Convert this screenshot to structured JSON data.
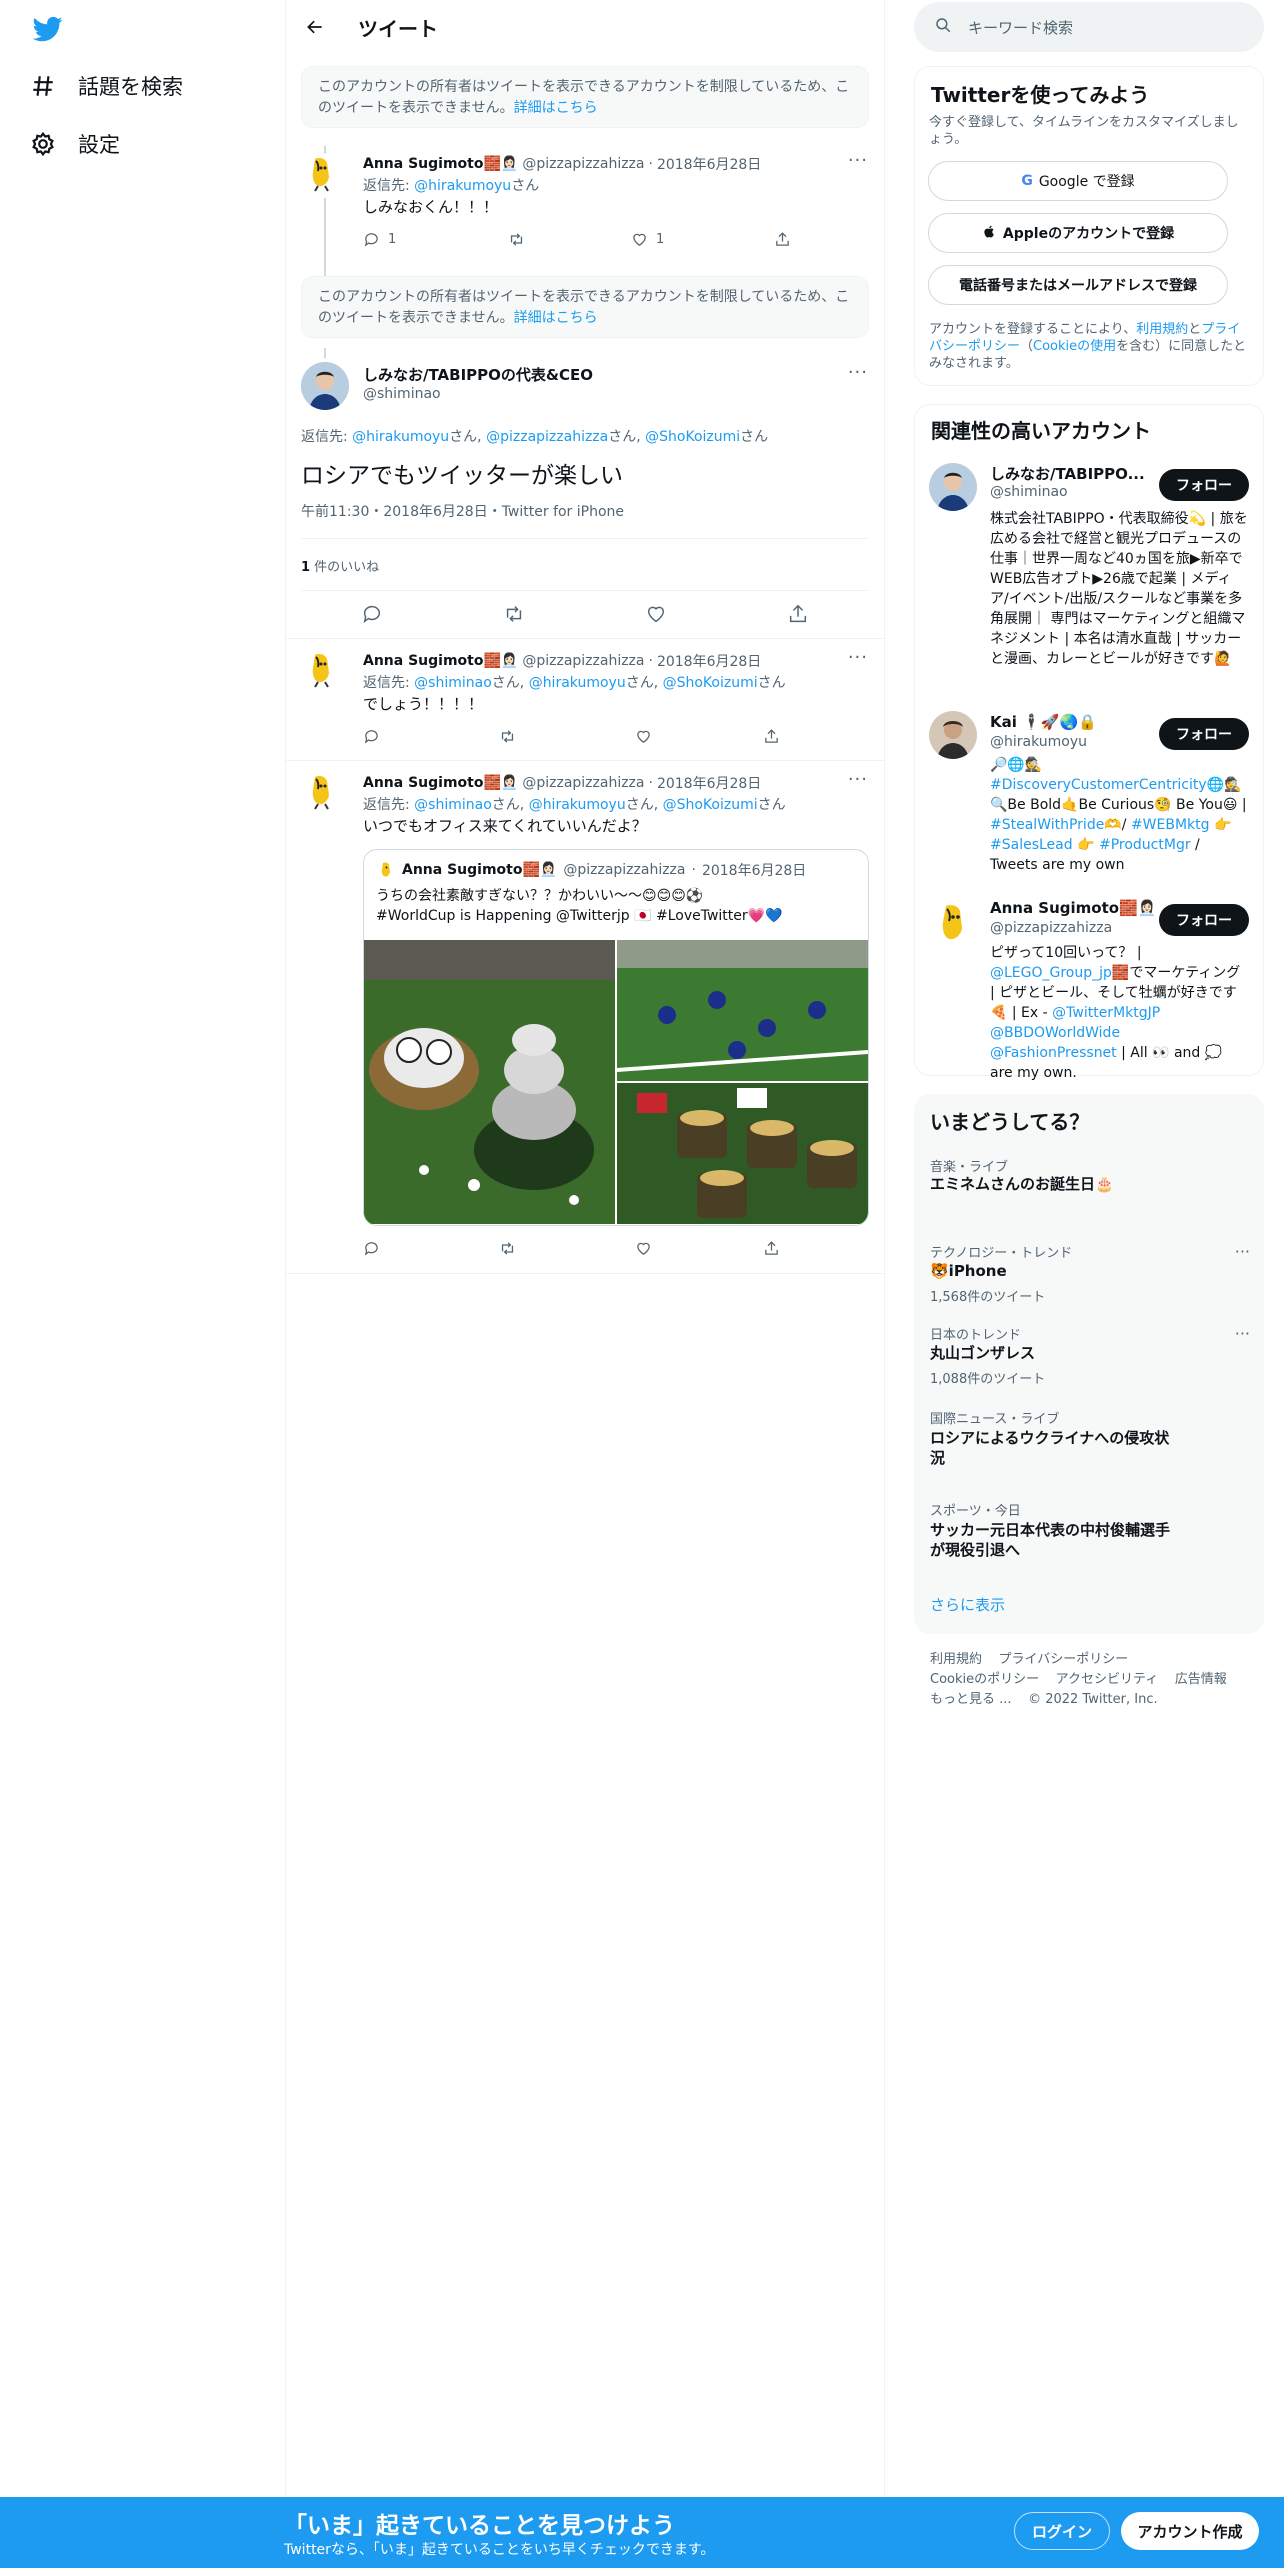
{
  "nav": {
    "explore_label": "話題を検索",
    "settings_label": "設定"
  },
  "header": {
    "title": "ツイート"
  },
  "notice": {
    "text": "このアカウントの所有者はツイートを表示できるアカウントを制限しているため、このツイートを表示できません。",
    "more_link": "詳細はこちら"
  },
  "tweet1": {
    "name": "Anna Sugimoto🧱👩🏻‍💼",
    "handle": "@pizzapizzahizza",
    "dot": "·",
    "date": "2018年6月28日",
    "reply_prefix": "返信先: ",
    "reply_to": "@hirakumoyu",
    "reply_suffix": "さん",
    "text": "しみなおくん！！！",
    "replies": "1",
    "likes": "1"
  },
  "focal": {
    "name": "しみなお/TABIPPOの代表&CEO",
    "handle": "@shiminao",
    "reply_prefix": "返信先: ",
    "reply_m1": "@hirakumoyu",
    "reply_s1": "さん, ",
    "reply_m2": "@pizzapizzahizza",
    "reply_s2": "さん, ",
    "reply_m3": "@ShoKoizumi",
    "reply_s3": "さん",
    "text": "ロシアでもツイッターが楽しい",
    "meta": "午前11:30・2018年6月28日・Twitter for iPhone",
    "likes_count": "1",
    "likes_label": " 件のいいね"
  },
  "tweet2": {
    "name": "Anna Sugimoto🧱👩🏻‍💼",
    "handle": "@pizzapizzahizza",
    "dot": "·",
    "date": "2018年6月28日",
    "reply_prefix": "返信先: ",
    "reply_m1": "@shiminao",
    "reply_s1": "さん, ",
    "reply_m2": "@hirakumoyu",
    "reply_s2": "さん, ",
    "reply_m3": "@ShoKoizumi",
    "reply_s3": "さん",
    "text": "でしょう！！！！"
  },
  "tweet3": {
    "name": "Anna Sugimoto🧱👩🏻‍💼",
    "handle": "@pizzapizzahizza",
    "dot": "·",
    "date": "2018年6月28日",
    "reply_prefix": "返信先: ",
    "reply_m1": "@shiminao",
    "reply_s1": "さん, ",
    "reply_m2": "@hirakumoyu",
    "reply_s2": "さん, ",
    "reply_m3": "@ShoKoizumi",
    "reply_s3": "さん",
    "text": "いつでもオフィス来てくれていいんだよ？",
    "quote": {
      "name": "Anna Sugimoto🧱👩🏻‍💼",
      "handle": "@pizzapizzahizza",
      "dot": "·",
      "date": "2018年6月28日",
      "line1": "うちの会社素敵すぎない？？かわいい〜〜😊😊😊⚽",
      "line2": "#WorldCup is Happening @Twitterjp 🇯🇵 #LoveTwitter💗💙"
    }
  },
  "search": {
    "placeholder": "キーワード検索"
  },
  "signup": {
    "title": "Twitterを使ってみよう",
    "subtitle": "今すぐ登録して、タイムラインをカスタマイズしましょう。",
    "google": "Google で登録",
    "apple": "Appleのアカウントで登録",
    "phone": "電話番号またはメールアドレスで登録",
    "legal_1": "アカウントを登録することにより、",
    "legal_link_1": "利用規約",
    "legal_2": "と",
    "legal_link_2": "プライバシーポリシー",
    "legal_3": "（",
    "legal_link_3": "Cookieの使用",
    "legal_4": "を含む）に同意したとみなされます。"
  },
  "related": {
    "title": "関連性の高いアカウント",
    "follow_label": "フォロー",
    "accounts": [
      {
        "name": "しみなお/TABIPPO...",
        "handle": "@shiminao",
        "bio": "株式会社TABIPPO・代表取締役💫 | 旅を広める会社で経営と観光プロデュースの仕事｜世界一周など40ヵ国を旅▶新卒でWEB広告オプト▶26歳で起業 | メディア/イベント/出版/スクールなど事業を多角展開｜ 専門はマーケティングと組織マネジメント | 本名は清水直哉 | サッカーと漫画、カレーとビールが好きです🙋"
      },
      {
        "name": "Kai 🕴🏻🚀🌏🔒",
        "handle": "@hirakumoyu",
        "bio_1": "🔎🌐🕵 ",
        "bio_link_1": "#DiscoveryCustomerCentricity",
        "bio_2": "🌐🕵 🔍Be Bold🤙Be Curious🧐 Be You😃 | ",
        "bio_link_2": "#StealWithPride",
        "bio_3": "🫶/ ",
        "bio_link_3": "#WEBMktg",
        "bio_4": " 👉 ",
        "bio_link_4": "#SalesLead",
        "bio_5": " 👉 ",
        "bio_link_5": "#ProductMgr",
        "bio_6": " / Tweets are my own"
      },
      {
        "name": "Anna Sugimoto🧱👩🏻‍💼",
        "handle": "@pizzapizzahizza",
        "bio_1": "ピザって10回いって？ | ",
        "bio_link_1": "@LEGO_Group_jp",
        "bio_2": "🧱でマーケティング | ピザとビール、そして牡蠣が好きです🍕 | Ex - ",
        "bio_link_2": "@TwitterMktgJP",
        "bio_3": " ",
        "bio_link_3": "@BBDOWorldWide",
        "bio_4": " ",
        "bio_link_4": "@FashionPressnet",
        "bio_5": " | All 👀 and 💭 are my own."
      }
    ]
  },
  "trends": {
    "title": "いまどうしてる？",
    "items": [
      {
        "category": "音楽・ライブ",
        "title": "エミネムさんのお誕生日🎂",
        "count": ""
      },
      {
        "category": "テクノロジー・トレンド",
        "title": "🐯iPhone",
        "count": "1,568件のツイート"
      },
      {
        "category": "日本のトレンド",
        "title": "丸山ゴンザレス",
        "count": "1,088件のツイート"
      },
      {
        "category": "国際ニュース・ライブ",
        "title": "ロシアによるウクライナへの侵攻状況",
        "count": ""
      },
      {
        "category": "スポーツ・今日",
        "title": "サッカー元日本代表の中村俊輔選手が現役引退へ",
        "count": ""
      }
    ],
    "show_more": "さらに表示"
  },
  "footer": {
    "terms": "利用規約",
    "privacy": "プライバシーポリシー",
    "cookie": "Cookieのポリシー",
    "accessibility": "アクセシビリティ",
    "ads": "広告情報",
    "more": "もっと見る ...",
    "copyright": "© 2022 Twitter, Inc."
  },
  "bottom_bar": {
    "title": "「いま」起きていることを見つけよう",
    "subtitle": "Twitterなら、「いま」起きていることをいち早くチェックできます。",
    "login": "ログイン",
    "signup": "アカウント作成"
  },
  "colors": {
    "brand": "#1d9bf0",
    "text": "#0f1419",
    "muted": "#536471",
    "border": "#eff3f4"
  }
}
